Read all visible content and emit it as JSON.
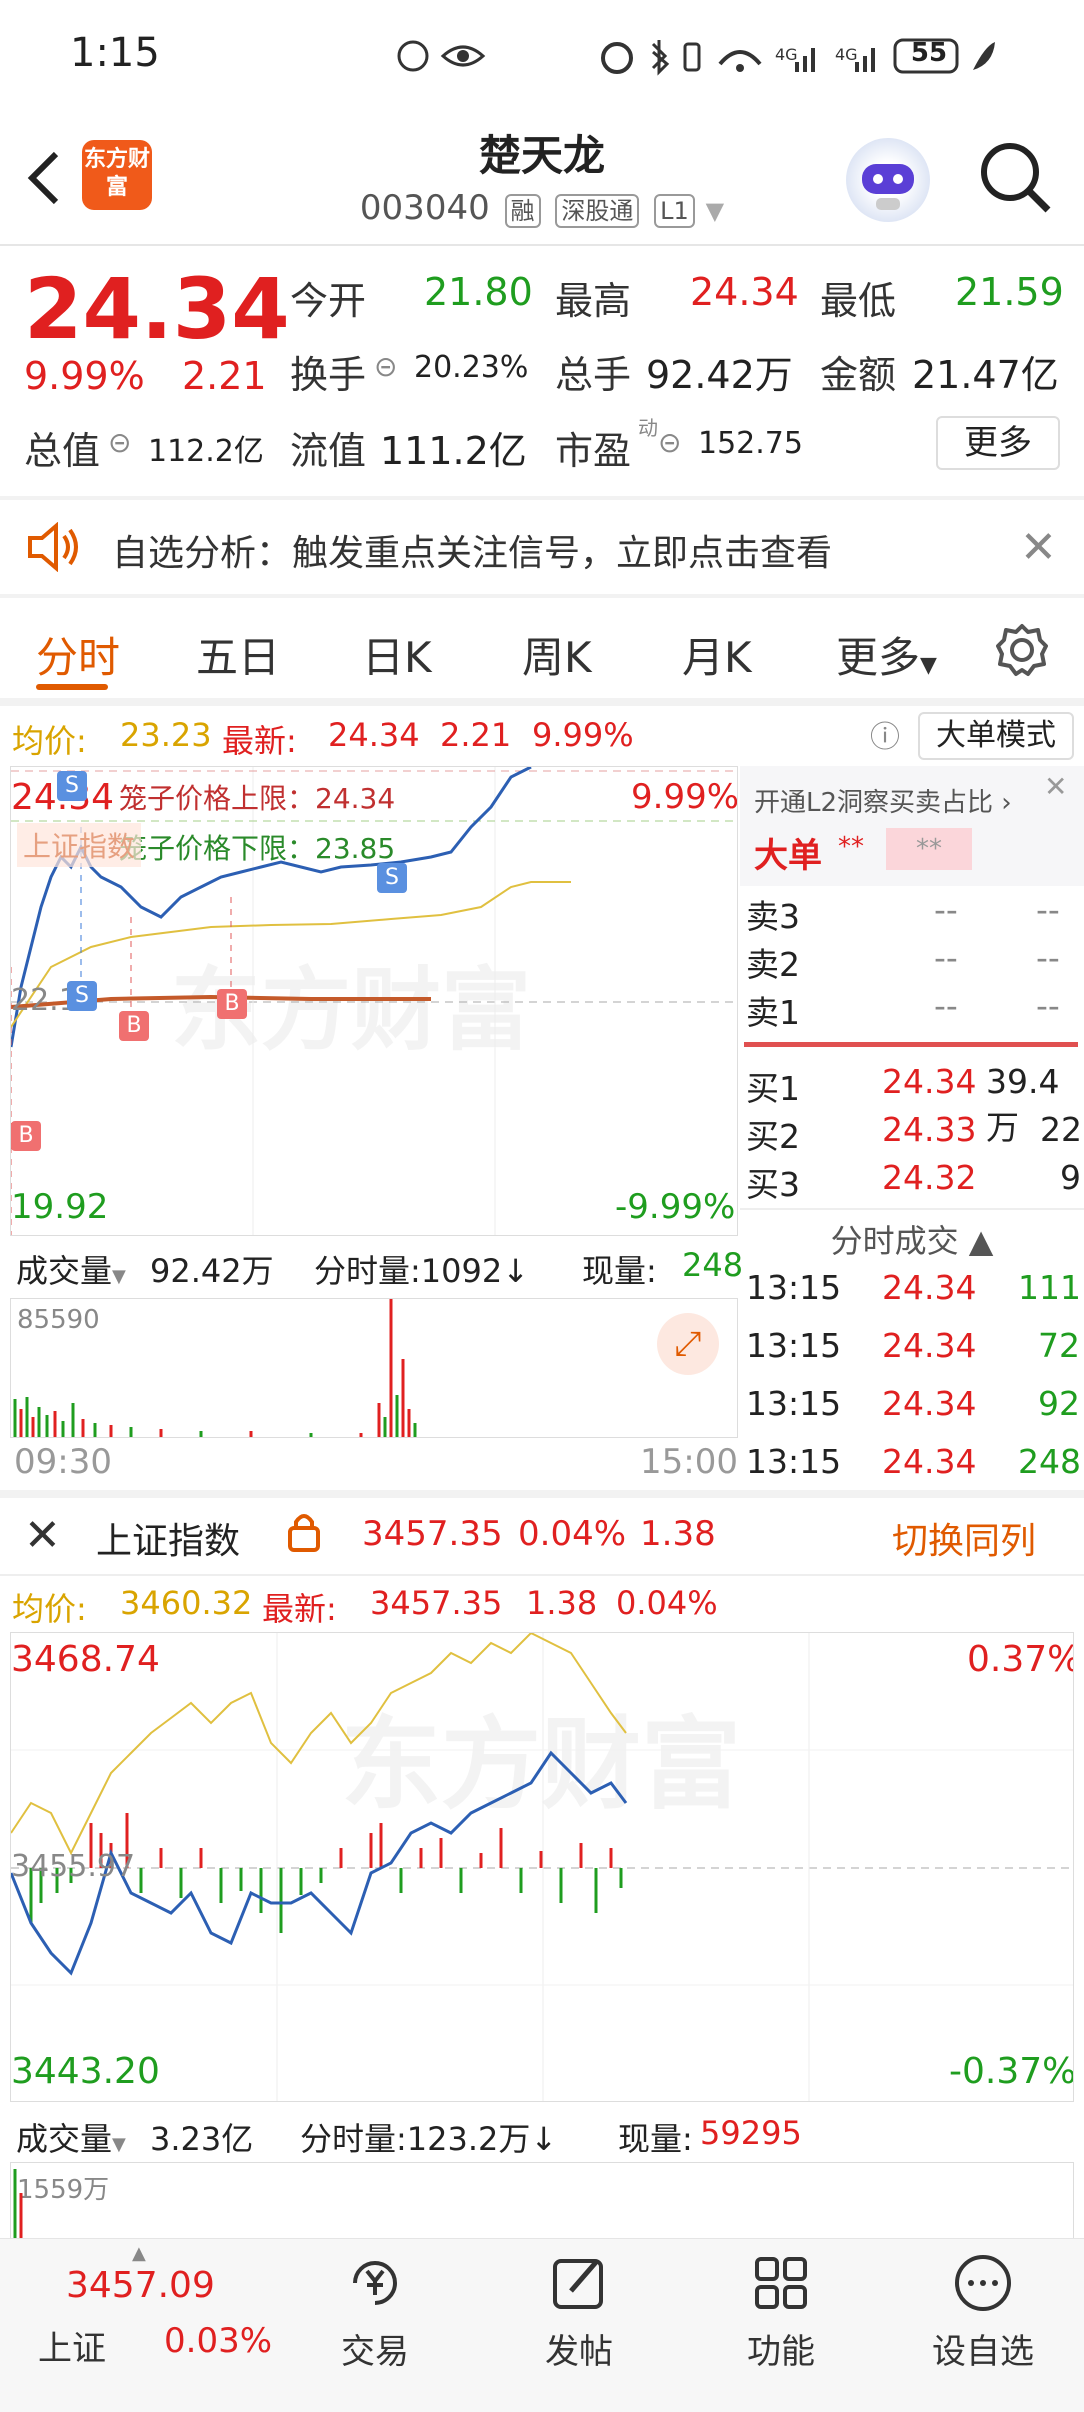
{
  "status_bar": {
    "time": "1:15",
    "battery": "55"
  },
  "header": {
    "logo_text": "东方财富",
    "title": "楚天龙",
    "code": "003040",
    "tags": [
      "融",
      "深股通",
      "L1"
    ]
  },
  "quote": {
    "price": "24.34",
    "change_pct": "9.99%",
    "change": "2.21",
    "open_label": "今开",
    "open": "21.80",
    "high_label": "最高",
    "high": "24.34",
    "low_label": "最低",
    "low": "21.59",
    "turnover_label": "换手",
    "turnover": "20.23%",
    "volume_label": "总手",
    "volume": "92.42万",
    "amount_label": "金额",
    "amount": "21.47亿",
    "mcap_label": "总值",
    "mcap": "112.2亿",
    "float_label": "流值",
    "float": "111.2亿",
    "pe_label": "市盈",
    "pe_sup": "动",
    "pe": "152.75",
    "more_button": "更多"
  },
  "notice": {
    "text": "自选分析：触发重点关注信号，立即点击查看"
  },
  "tabs": [
    {
      "label": "分时",
      "active": true
    },
    {
      "label": "五日",
      "active": false
    },
    {
      "label": "日K",
      "active": false
    },
    {
      "label": "周K",
      "active": false
    },
    {
      "label": "月K",
      "active": false
    },
    {
      "label": "更多",
      "active": false
    }
  ],
  "intraday": {
    "avg_label": "均价:",
    "avg": "23.23",
    "latest_label": "最新:",
    "latest": "24.34",
    "chg": "2.21",
    "pct": "9.99%",
    "mode_button": "大单模式",
    "top_price": "24.34",
    "top_pct": "9.99%",
    "bottom_price": "19.92",
    "bottom_pct": "-9.99%",
    "mid_price": "22.13",
    "cage_upper": "笼子价格上限：24.34",
    "cage_lower": "笼子价格下限：23.85",
    "overlay_label": "上证指数",
    "vol_selector": "成交量",
    "vol_total": "92.42万",
    "vol_tick_label": "分时量:1092↓",
    "vol_now_label": "现量:",
    "vol_now": "248",
    "vol_max": "85590",
    "time_start": "09:30",
    "time_end": "15:00",
    "watermark": "东方财富"
  },
  "orderbook": {
    "banner": "开通L2洞察买卖占比 ›",
    "big_label": "大单",
    "big_val1": "**",
    "big_val2": "**",
    "asks": [
      {
        "label": "卖3",
        "price": "--",
        "qty": "--"
      },
      {
        "label": "卖2",
        "price": "--",
        "qty": "--"
      },
      {
        "label": "卖1",
        "price": "--",
        "qty": "--"
      }
    ],
    "bids": [
      {
        "label": "买1",
        "price": "24.34",
        "qty": "39.4万"
      },
      {
        "label": "买2",
        "price": "24.33",
        "qty": "22"
      },
      {
        "label": "买3",
        "price": "24.32",
        "qty": "9"
      }
    ],
    "trades_title": "分时成交 ▲",
    "trades": [
      {
        "time": "13:15",
        "price": "24.34",
        "qty": "111"
      },
      {
        "time": "13:15",
        "price": "24.34",
        "qty": "72"
      },
      {
        "time": "13:15",
        "price": "24.34",
        "qty": "92"
      },
      {
        "time": "13:15",
        "price": "24.34",
        "qty": "248"
      }
    ]
  },
  "index_panel": {
    "name": "上证指数",
    "value": "3457.35",
    "pct": "0.04%",
    "chg": "1.38",
    "switch_label": "切换同列",
    "avg_label": "均价:",
    "avg": "3460.32",
    "latest_label": "最新:",
    "latest": "3457.35",
    "chg2": "1.38",
    "pct2": "0.04%",
    "top": "3468.74",
    "top_pct": "0.37%",
    "bottom": "3443.20",
    "bottom_pct": "-0.37%",
    "mid": "3455.97",
    "vol_selector": "成交量",
    "vol_total": "3.23亿",
    "vol_tick_label": "分时量:123.2万↓",
    "vol_now_label": "现量:",
    "vol_now": "59295",
    "vol_max": "1559万",
    "watermark": "东方财富"
  },
  "bottom_nav": {
    "index_value": "3457.09",
    "index_name": "上证",
    "index_pct": "0.03%",
    "items": [
      "交易",
      "发帖",
      "功能",
      "设自选"
    ]
  },
  "colors": {
    "up": "#e02020",
    "down": "#1f9d1f",
    "accent": "#e05a00",
    "avg": "#d9a400",
    "line": "#2c5fb3"
  }
}
